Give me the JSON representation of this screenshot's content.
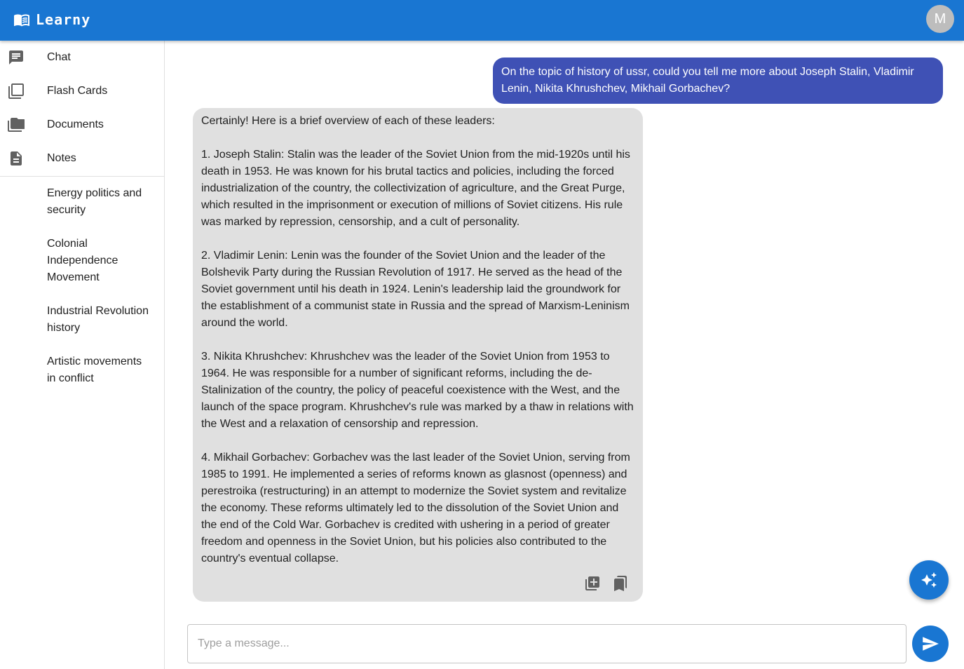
{
  "app": {
    "name": "Learny",
    "avatar_initial": "M"
  },
  "nav": [
    {
      "label": "Chat",
      "icon": "chat-icon"
    },
    {
      "label": "Flash Cards",
      "icon": "flash-cards-icon"
    },
    {
      "label": "Documents",
      "icon": "folder-icon"
    },
    {
      "label": "Notes",
      "icon": "note-icon"
    }
  ],
  "notes": [
    "Energy politics and security",
    "Colonial Independence Movement",
    "Industrial Revolution history",
    "Artistic movements in conflict"
  ],
  "chat": {
    "user_message": "On the topic of history of ussr, could you tell me more about Joseph Stalin, Vladimir Lenin, Nikita Khrushchev, Mikhail Gorbachev?",
    "bot_paragraphs": [
      "Certainly! Here is a brief overview of each of these leaders:",
      "1. Joseph Stalin: Stalin was the leader of the Soviet Union from the mid-1920s until his death in 1953. He was known for his brutal tactics and policies, including the forced industrialization of the country, the collectivization of agriculture, and the Great Purge, which resulted in the imprisonment or execution of millions of Soviet citizens. His rule was marked by repression, censorship, and a cult of personality.",
      "2. Vladimir Lenin: Lenin was the founder of the Soviet Union and the leader of the Bolshevik Party during the Russian Revolution of 1917. He served as the head of the Soviet government until his death in 1924. Lenin's leadership laid the groundwork for the establishment of a communist state in Russia and the spread of Marxism-Leninism around the world.",
      "3. Nikita Khrushchev: Khrushchev was the leader of the Soviet Union from 1953 to 1964. He was responsible for a number of significant reforms, including the de-Stalinization of the country, the policy of peaceful coexistence with the West, and the launch of the space program. Khrushchev's rule was marked by a thaw in relations with the West and a relaxation of censorship and repression.",
      "4. Mikhail Gorbachev: Gorbachev was the last leader of the Soviet Union, serving from 1985 to 1991. He implemented a series of reforms known as glasnost (openness) and perestroika (restructuring) in an attempt to modernize the Soviet system and revitalize the economy. These reforms ultimately led to the dissolution of the Soviet Union and the end of the Cold War. Gorbachev is credited with ushering in a period of greater freedom and openness in the Soviet Union, but his policies also contributed to the country's eventual collapse."
    ],
    "input_placeholder": "Type a message...",
    "input_value": ""
  },
  "colors": {
    "appbar": "#1976d2",
    "user_bubble": "#3f51b5",
    "bot_bubble": "#e0e0e0",
    "icon_gray": "#616161"
  }
}
